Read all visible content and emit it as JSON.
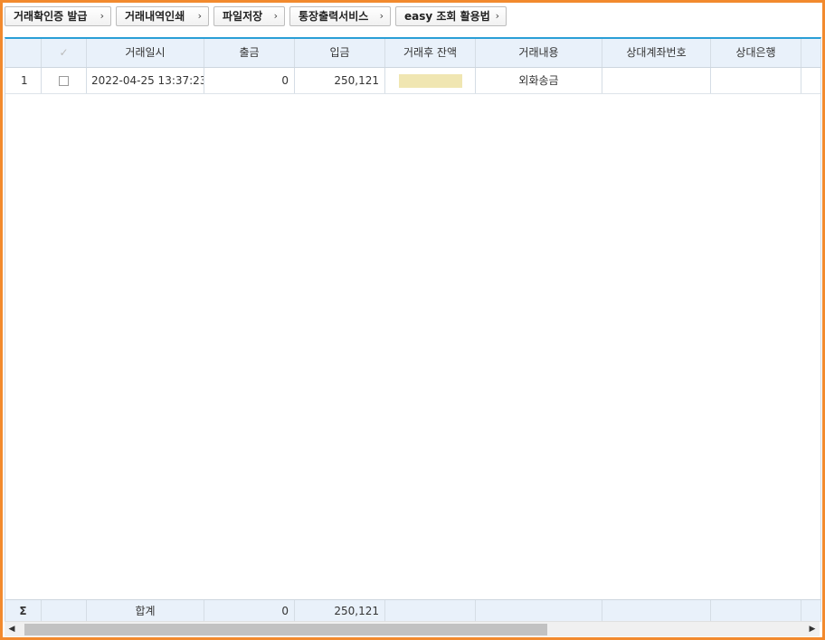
{
  "toolbar": {
    "buttons": [
      {
        "label": "거래확인증 발급"
      },
      {
        "label": "거래내역인쇄"
      },
      {
        "label": "파일저장"
      },
      {
        "label": "통장출력서비스"
      },
      {
        "label": "easy 조회 활용법"
      }
    ],
    "chevron": "›"
  },
  "grid": {
    "check_header": "✓",
    "columns": [
      "거래일시",
      "출금",
      "입금",
      "거래후 잔액",
      "거래내용",
      "상대계좌번호",
      "상대은행"
    ],
    "rows": [
      {
        "no": "1",
        "datetime": "2022-04-25 13:37:23",
        "withdrawal": "0",
        "deposit": "250,121",
        "balance": "",
        "description": "외화송금",
        "counter_account": "",
        "counter_bank": ""
      }
    ],
    "footer": {
      "sigma": "Σ",
      "label": "합계",
      "withdrawal_total": "0",
      "deposit_total": "250,121"
    }
  },
  "scrollbar": {
    "left_arrow": "◀",
    "right_arrow": "▶"
  }
}
